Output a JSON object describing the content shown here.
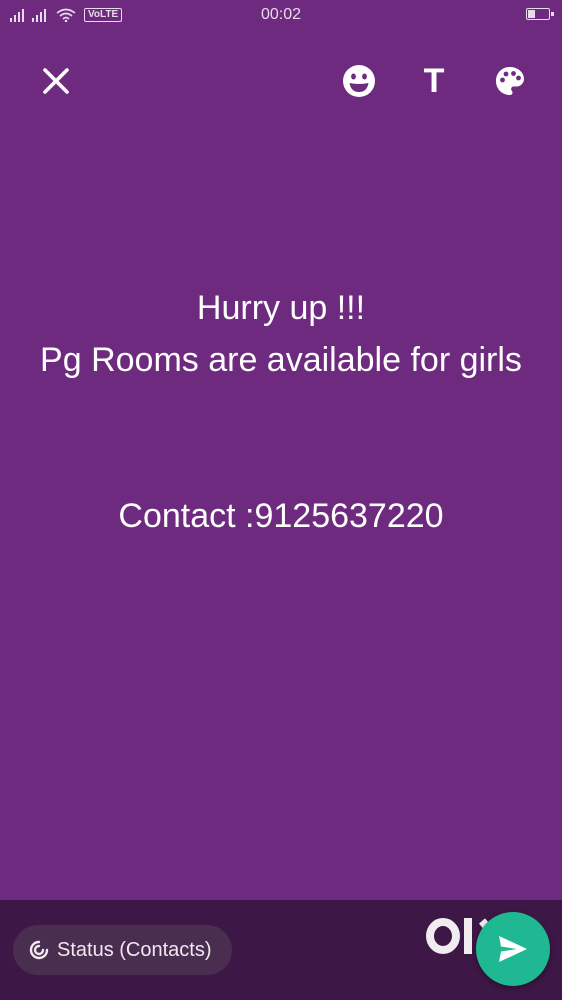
{
  "status_bar": {
    "time": "00:02",
    "network_badge": "VoLTE"
  },
  "toolbar": {
    "close_icon": "close-icon",
    "emoji_icon": "emoji-icon",
    "text_label": "T",
    "palette_icon": "palette-icon"
  },
  "status_text": {
    "body": "Hurry up !!!\nPg Rooms are available for girls\n\n\nContact :9125637220"
  },
  "footer": {
    "audience_label": "Status (Contacts)",
    "send_icon": "send-icon",
    "watermark": "OLX"
  },
  "colors": {
    "background": "#6e2a7e",
    "bottom_bar": "#3d1745",
    "send_button": "#1fb892"
  }
}
